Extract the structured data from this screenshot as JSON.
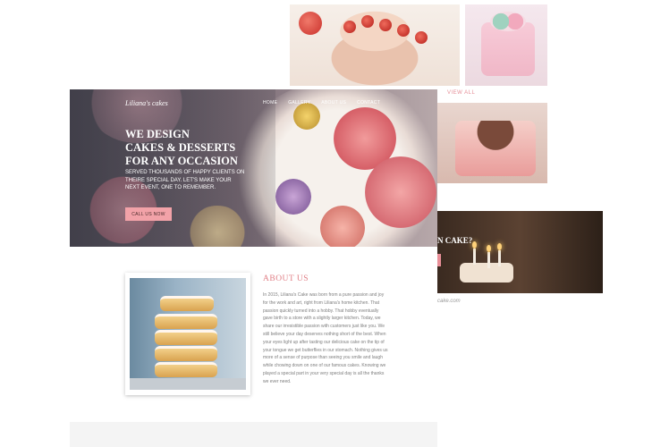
{
  "background": {
    "view_all": "VIEW ALL",
    "cake_question": "N CAKE?",
    "credit": "cake.com"
  },
  "header": {
    "logo": "Liliana's cakes",
    "nav": [
      "HOME",
      "GALLERY",
      "ABOUT US",
      "CONTACT"
    ]
  },
  "hero": {
    "headline_lines": [
      "WE DESIGN",
      "CAKES & DESSERTS",
      "FOR ANY OCCASION"
    ],
    "subtitle": "SERVED THOUSANDS OF HAPPY CLIENTS ON THEIRE SPECIAL DAY. LET'S MAKE YOUR NEXT EVENT, ONE TO REMEMBER.",
    "cta_label": "CALL US NOW"
  },
  "about": {
    "title": "ABOUT US",
    "body": "In 2015, Liliana's Cake was born from a pure passion and joy for the work and art, right from Liliana's home kitchen. That passion quickly turned into a hobby. That hobby eventually gave birth to a store with a slightly larger kitchen. Today, we share our irresistible passion with customers just like you. We still believe your day deserves nothing short of the best. When your eyes light up after tasting our delicious cake on the tip of your tongue we get butterflies in our stomach. Nothing gives us more of a sense of purpose than seeing you smile and laugh while chowing down on one of our famous cakes. Knowing we played a special part in your very special day is all the thanks we ever need."
  },
  "colors": {
    "accent_pink": "#f2a2a8",
    "title_pink": "#e07f86",
    "body_gray": "#7e7e7e"
  }
}
